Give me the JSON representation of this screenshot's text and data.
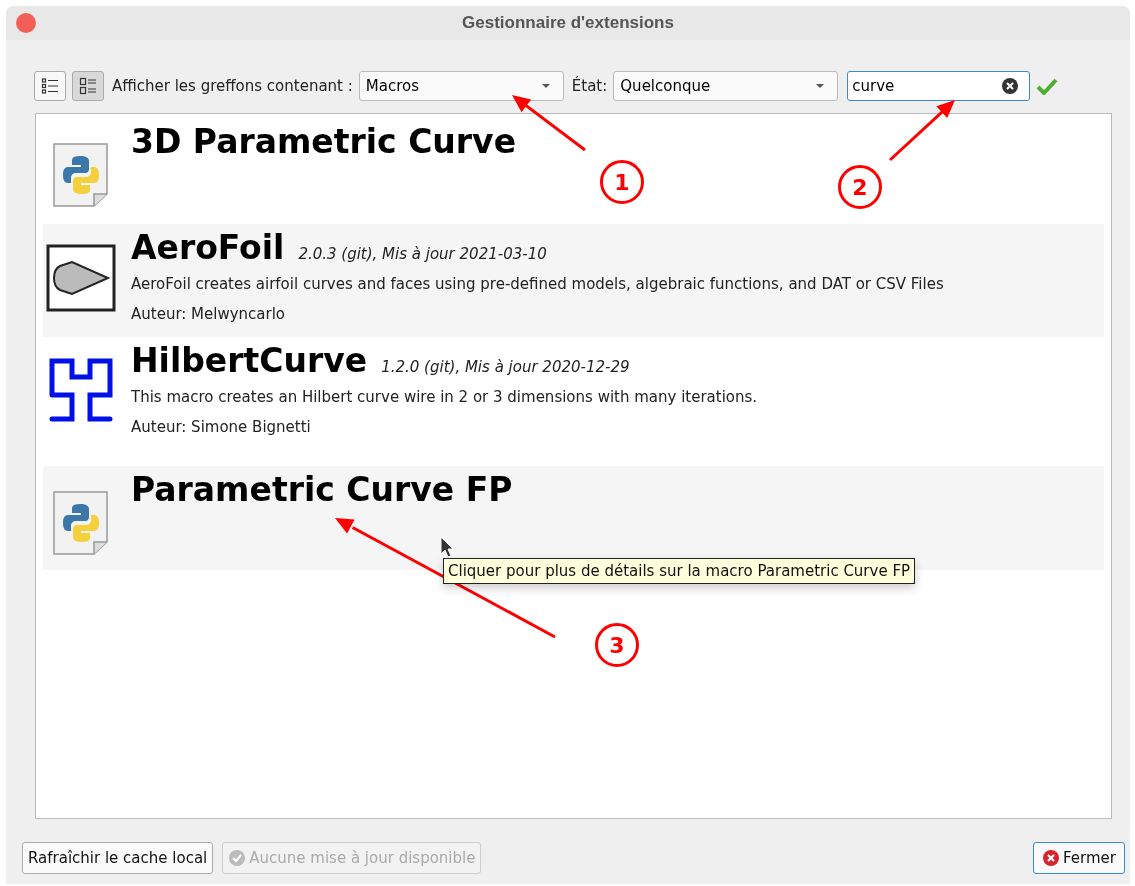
{
  "window": {
    "title": "Gestionnaire d'extensions"
  },
  "toolbar": {
    "view_buttons": [
      {
        "kind": "compact",
        "selected": false
      },
      {
        "kind": "expanded",
        "selected": true
      }
    ],
    "filter_label": "Afficher les greffons contenant :",
    "filter_value": "Macros",
    "state_label": "État:",
    "state_value": "Quelconque",
    "search_value": "curve"
  },
  "plugins": [
    {
      "name": "3D Parametric Curve",
      "kind": "python"
    },
    {
      "name": "AeroFoil",
      "version": "2.0.3 (git), Mis à jour 2021-03-10",
      "description": "AeroFoil creates airfoil curves and faces using pre-defined models, algebraic functions, and DAT or CSV Files",
      "author": "Auteur: Melwyncarlo",
      "kind": "airfoil"
    },
    {
      "name": "HilbertCurve",
      "version": "1.2.0 (git), Mis à jour 2020-12-29",
      "description": "This macro creates an Hilbert curve wire in 2 or 3 dimensions with many iterations.",
      "author": "Auteur: Simone Bignetti",
      "kind": "hilbert"
    },
    {
      "name": "Parametric Curve FP",
      "kind": "python"
    }
  ],
  "tooltip": "Cliquer pour plus de détails sur la macro Parametric Curve FP",
  "callouts": [
    "1",
    "2",
    "3"
  ],
  "buttons": [
    {
      "label": "Rafraîchir le cache local",
      "kind": "plain",
      "disabled": false
    },
    {
      "label": "Aucune mise à jour disponible",
      "kind": "check",
      "disabled": true
    },
    {
      "label": "Fermer",
      "kind": "close",
      "disabled": false
    }
  ]
}
